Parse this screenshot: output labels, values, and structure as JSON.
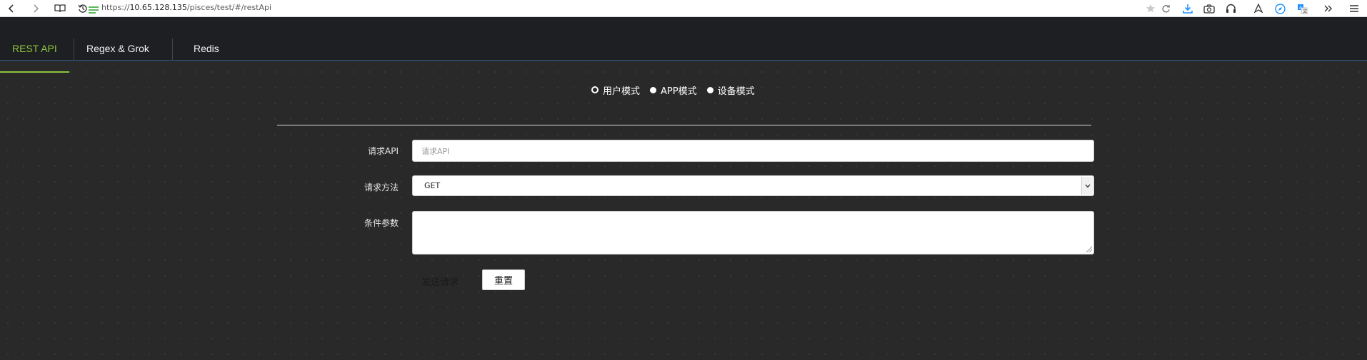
{
  "browser": {
    "url_prefix": "https://",
    "url_host": "10.65.128.135",
    "url_path": "/pisces/test/#/restApi"
  },
  "tabs": [
    {
      "label": "REST API",
      "active": true
    },
    {
      "label": "Regex & Grok",
      "active": false
    },
    {
      "label": "Redis",
      "active": false
    }
  ],
  "modes": {
    "options": [
      "用户模式",
      "APP模式",
      "设备模式"
    ],
    "selected": "用户模式"
  },
  "form": {
    "api_label": "请求API",
    "api_placeholder": "请求API",
    "api_value": "",
    "method_label": "请求方法",
    "method_value": "GET",
    "params_label": "条件参数",
    "params_value": ""
  },
  "buttons": {
    "send": "发送请求",
    "reset": "重置"
  },
  "colors": {
    "accent_green": "#8cc63f",
    "tab_band_border": "#2e5a8a",
    "background": "#292929"
  },
  "icons": [
    "back-icon",
    "forward-icon",
    "reader-icon",
    "history-icon",
    "secure-icon",
    "star-icon",
    "reload-icon",
    "download-icon",
    "camera-icon",
    "headphones-icon",
    "share-icon",
    "compass-icon",
    "translate-icon",
    "more-icon",
    "menu-icon"
  ]
}
